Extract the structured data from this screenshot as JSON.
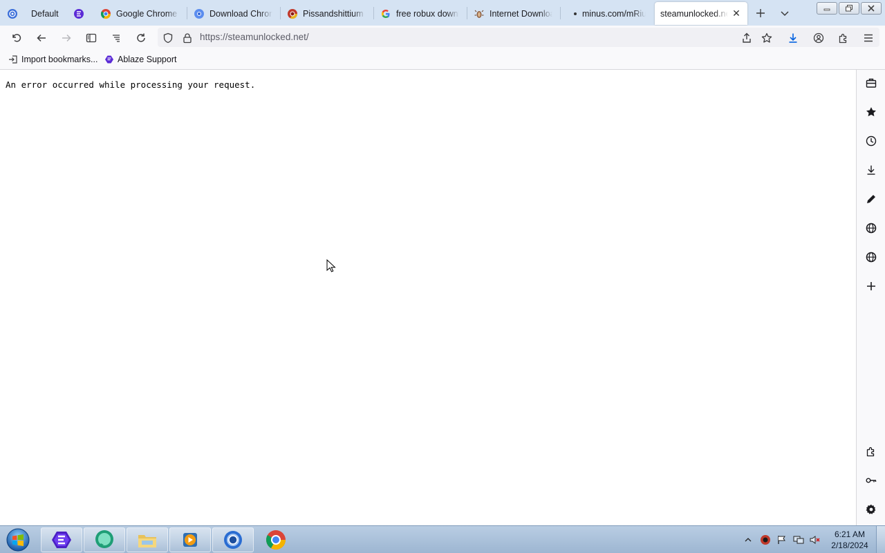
{
  "browser": {
    "profile_tab_label": "Default",
    "tabs": [
      {
        "title": "Google Chrome W",
        "icon": "chrome-icon",
        "active": false
      },
      {
        "title": "Download Chrom",
        "icon": "chrome-blue-icon",
        "active": false
      },
      {
        "title": "Pissandshittium",
        "icon": "chromium-red-icon",
        "active": false
      },
      {
        "title": "free robux downlo",
        "icon": "google-g-icon",
        "active": false
      },
      {
        "title": "Internet Downloa",
        "icon": "bug-icon",
        "active": false
      },
      {
        "title": "minus.com/mRiu",
        "icon": "dot-icon",
        "active": false
      },
      {
        "title": "steamunlocked.net",
        "icon": "none",
        "active": true
      }
    ],
    "url": "https://steamunlocked.net/",
    "bookmarks": [
      {
        "label": "Import bookmarks...",
        "icon": "import-icon"
      },
      {
        "label": "Ablaze Support",
        "icon": "ablaze-icon"
      }
    ]
  },
  "page": {
    "error_message": "An error occurred while processing your request."
  },
  "sidebar": {
    "items": [
      "toolbox-icon",
      "star-icon",
      "history-icon",
      "download-icon",
      "pencil-icon",
      "globe-icon",
      "globe-icon",
      "plus-icon",
      "puzzle-icon",
      "key-icon",
      "gear-icon"
    ]
  },
  "taskbar": {
    "apps": [
      "ablaze-browser",
      "messenger-app",
      "file-explorer",
      "media-player",
      "chromium-app",
      "google-chrome"
    ],
    "time": "6:21 AM",
    "date": "2/18/2024"
  },
  "colors": {
    "tabstrip_bg": "#d5e3f3",
    "toolbar_bg": "#f9f9fb",
    "taskbar_bg": "#a8c0dc",
    "ablaze_purple": "#5b2bd6"
  }
}
